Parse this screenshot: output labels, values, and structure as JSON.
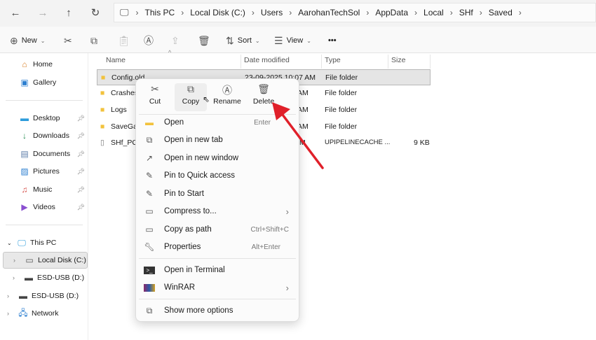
{
  "nav": {
    "back": "←",
    "forward": "→",
    "up": "↑",
    "refresh": "↻"
  },
  "breadcrumb": [
    "This PC",
    "Local Disk (C:)",
    "Users",
    "AarohanTechSol",
    "AppData",
    "Local",
    "SHf",
    "Saved"
  ],
  "toolbar": {
    "new": "New",
    "sort": "Sort",
    "view": "View",
    "more": "•••"
  },
  "sidebar": {
    "quick": [
      {
        "label": "Home",
        "icon": "home-icon"
      },
      {
        "label": "Gallery",
        "icon": "gallery-icon"
      }
    ],
    "pinned": [
      {
        "label": "Desktop"
      },
      {
        "label": "Downloads"
      },
      {
        "label": "Documents"
      },
      {
        "label": "Pictures"
      },
      {
        "label": "Music"
      },
      {
        "label": "Videos"
      }
    ],
    "tree": [
      {
        "label": "This PC"
      },
      {
        "label": "Local Disk (C:)"
      },
      {
        "label": "ESD-USB (D:)"
      },
      {
        "label": "ESD-USB (D:)"
      },
      {
        "label": "Network"
      }
    ]
  },
  "columns": {
    "name": "Name",
    "date": "Date modified",
    "type": "Type",
    "size": "Size"
  },
  "files": [
    {
      "name": "Config.old",
      "date": "23-09-2025 10:07 AM",
      "type": "File folder",
      "size": ""
    },
    {
      "name": "Crashes",
      "date": "AM",
      "type": "File folder",
      "size": ""
    },
    {
      "name": "Logs",
      "date": "AM",
      "type": "File folder",
      "size": ""
    },
    {
      "name": "SaveGar",
      "date": "AM",
      "type": "File folder",
      "size": ""
    },
    {
      "name": "SHf_PCD",
      "date": "M",
      "type": "UPIPELINECACHE ...",
      "size": "9 KB"
    }
  ],
  "context_menu": {
    "quick_actions": [
      {
        "label": "Cut",
        "icon": "✂"
      },
      {
        "label": "Copy",
        "icon": "⧉"
      },
      {
        "label": "Rename",
        "icon": "Ⓐ"
      },
      {
        "label": "Delete",
        "icon": "🗑"
      }
    ],
    "items": [
      {
        "label": "Open",
        "shortcut": "Enter"
      },
      {
        "label": "Open in new tab",
        "shortcut": ""
      },
      {
        "label": "Open in new window",
        "shortcut": ""
      },
      {
        "label": "Pin to Quick access",
        "shortcut": ""
      },
      {
        "label": "Pin to Start",
        "shortcut": ""
      },
      {
        "label": "Compress to...",
        "shortcut": "›"
      },
      {
        "label": "Copy as path",
        "shortcut": "Ctrl+Shift+C"
      },
      {
        "label": "Properties",
        "shortcut": "Alt+Enter"
      },
      {
        "label": "Open in Terminal",
        "shortcut": ""
      },
      {
        "label": "WinRAR",
        "shortcut": "›"
      },
      {
        "label": "Show more options",
        "shortcut": ""
      }
    ]
  },
  "colors": {
    "selection": "#e5e5e5",
    "arrow": "#e0202a",
    "folder": "#f2c23c"
  }
}
